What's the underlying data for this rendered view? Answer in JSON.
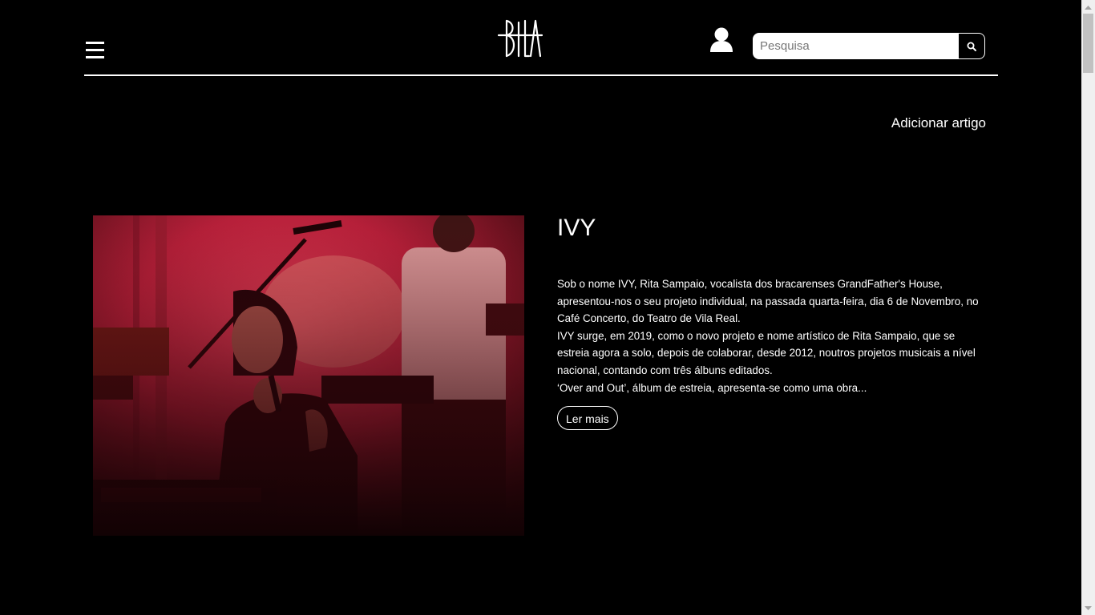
{
  "header": {
    "menu_icon": "hamburger-menu-icon",
    "logo_text": "BILA",
    "account_icon": "user-icon",
    "search": {
      "placeholder": "Pesquisa",
      "value": "",
      "icon": "search-icon"
    }
  },
  "toolbar": {
    "add_article_label": "Adicionar artigo"
  },
  "articles": [
    {
      "title": "IVY",
      "image_alt": "",
      "excerpt": "Sob o nome IVY, Rita Sampaio, vocalista dos bracarenses GrandFather's House, apresentou-nos o seu projeto individual, na passada quarta-feira, dia 6 de Novembro, no Café Concerto, do Teatro de Vila Real.\nIVY surge, em 2019, como o novo projeto e nome artístico de Rita Sampaio, que se estreia agora a solo, depois de colaborar, desde 2012, noutros projetos musicais a nível nacional, contando com três álbuns editados.\n‘Over and Out’, álbum de estreia, apresenta-se como uma obra...",
      "read_more_label": "Ler mais"
    }
  ],
  "colors": {
    "background": "#000000",
    "text": "#ffffff",
    "photo_tint": "#c4283f"
  }
}
